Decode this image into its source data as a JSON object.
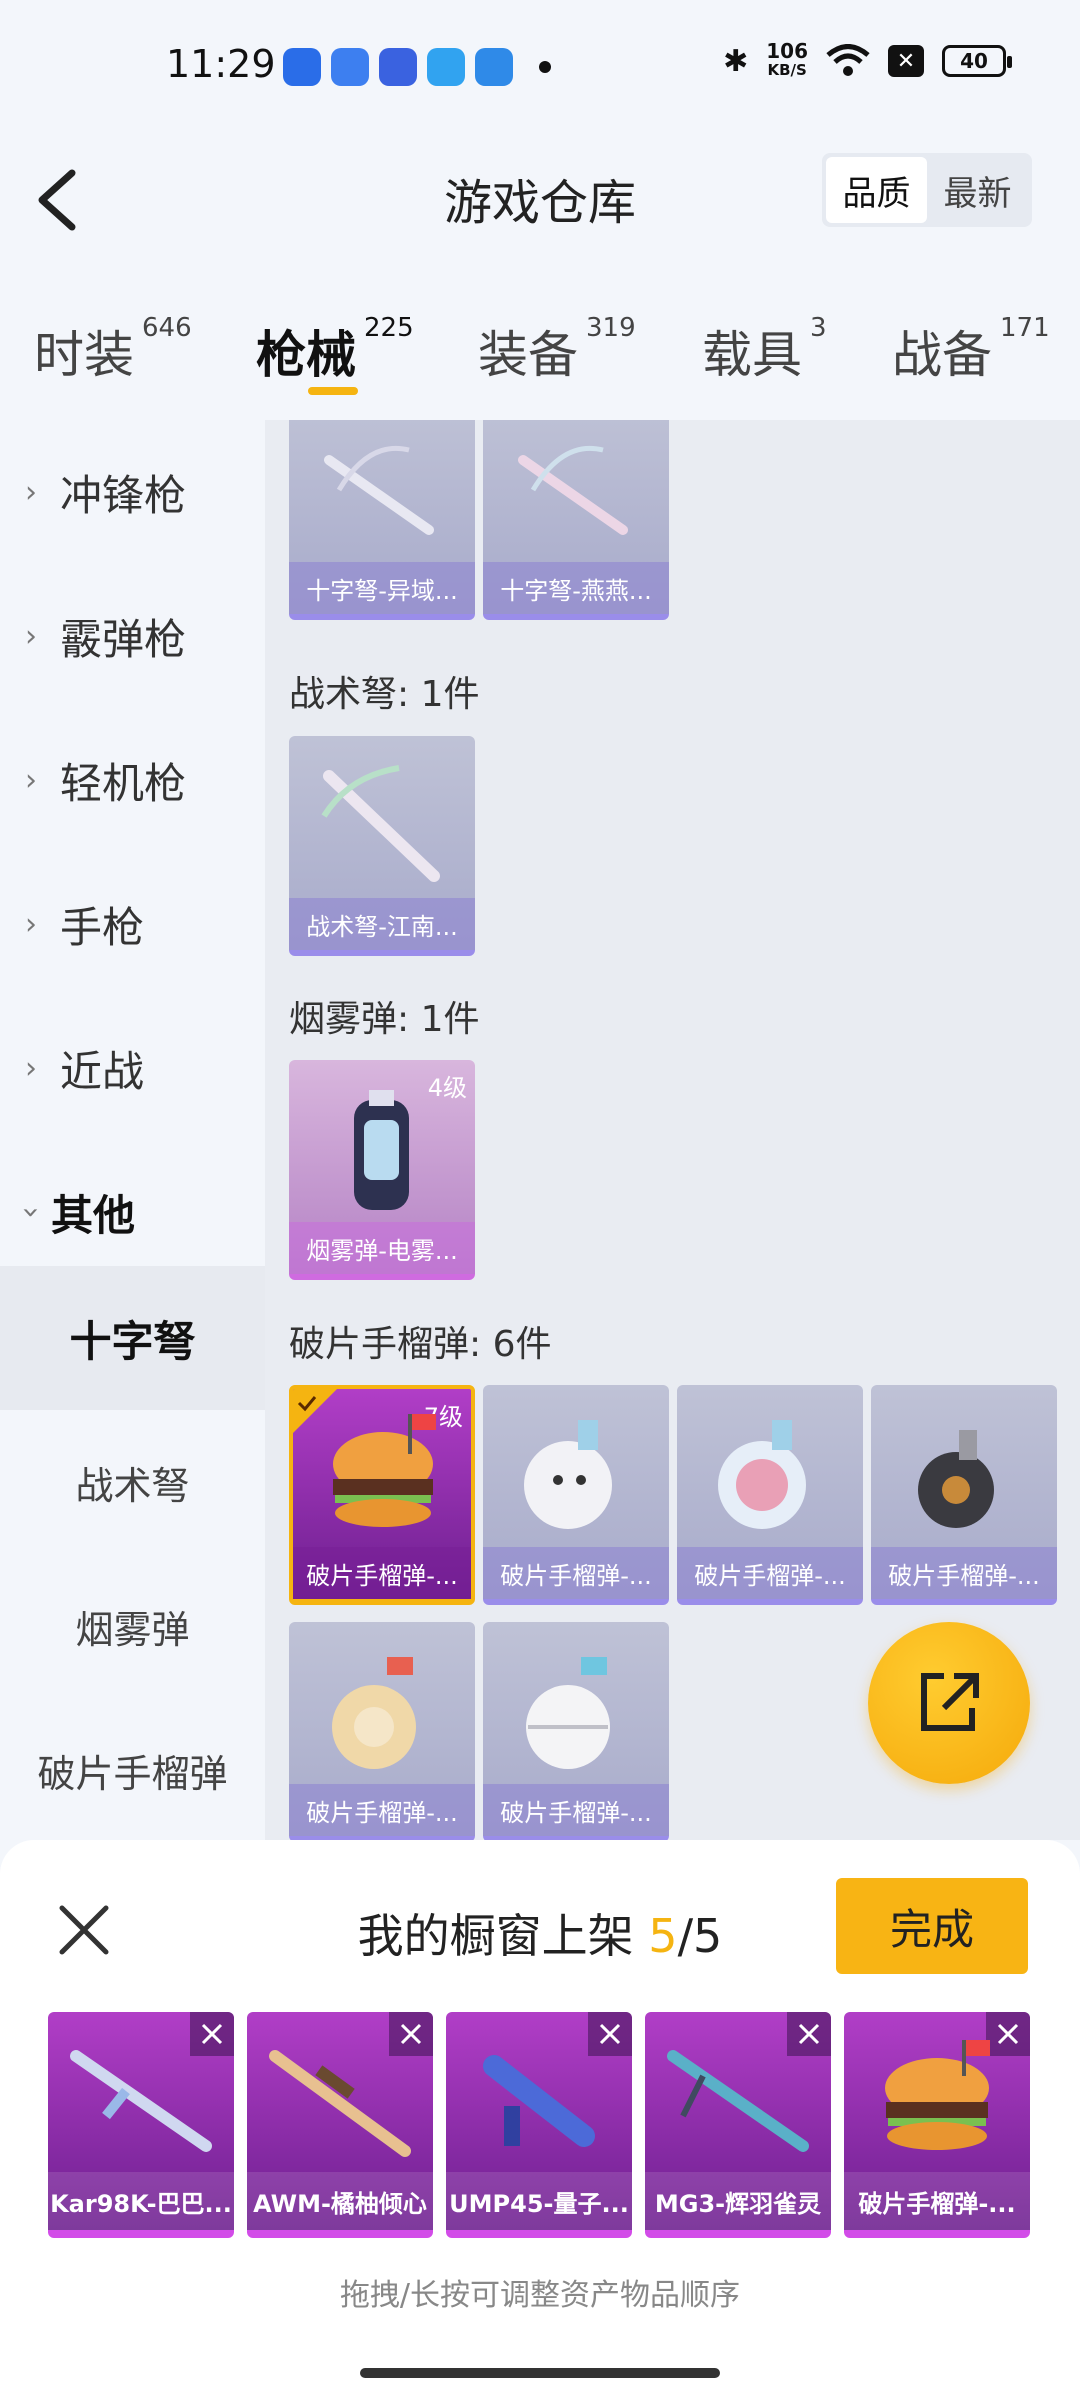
{
  "status": {
    "time": "11:29",
    "speed_value": "106",
    "speed_unit": "KB/S",
    "battery": "40"
  },
  "header": {
    "title": "游戏仓库",
    "sort_options": [
      "品质",
      "最新"
    ]
  },
  "tabs": [
    {
      "label": "时装",
      "count": "646"
    },
    {
      "label": "枪械",
      "count": "225"
    },
    {
      "label": "装备",
      "count": "319"
    },
    {
      "label": "载具",
      "count": "3"
    },
    {
      "label": "战备",
      "count": "171"
    }
  ],
  "sidebar": {
    "categories": [
      "冲锋枪",
      "霰弹枪",
      "轻机枪",
      "手枪",
      "近战",
      "其他"
    ],
    "subcategories": [
      "十字弩",
      "战术弩",
      "烟雾弹",
      "破片手榴弹"
    ]
  },
  "content": {
    "sections": [
      {
        "title": "战术弩: 1件"
      },
      {
        "title": "烟雾弹: 1件"
      },
      {
        "title": "破片手榴弹: 6件"
      }
    ],
    "crossbow_items": [
      "十字弩-异域...",
      "十字弩-燕燕..."
    ],
    "tactical_items": [
      "战术弩-江南..."
    ],
    "smoke_items": [
      {
        "name": "烟雾弹-电雾...",
        "level": "4级"
      }
    ],
    "grenade_items": [
      {
        "name": "破片手榴弹-...",
        "level": "7级"
      },
      {
        "name": "破片手榴弹-..."
      },
      {
        "name": "破片手榴弹-..."
      },
      {
        "name": "破片手榴弹-..."
      },
      {
        "name": "破片手榴弹-..."
      },
      {
        "name": "破片手榴弹-..."
      }
    ]
  },
  "panel": {
    "title_prefix": "我的橱窗上架 ",
    "count": "5",
    "total": "/5",
    "done_label": "完成",
    "items": [
      "Kar98K-巴巴...",
      "AWM-橘柚倾心",
      "UMP45-量子...",
      "MG3-辉羽雀灵",
      "破片手榴弹-..."
    ],
    "hint": "拖拽/长按可调整资产物品顺序"
  }
}
